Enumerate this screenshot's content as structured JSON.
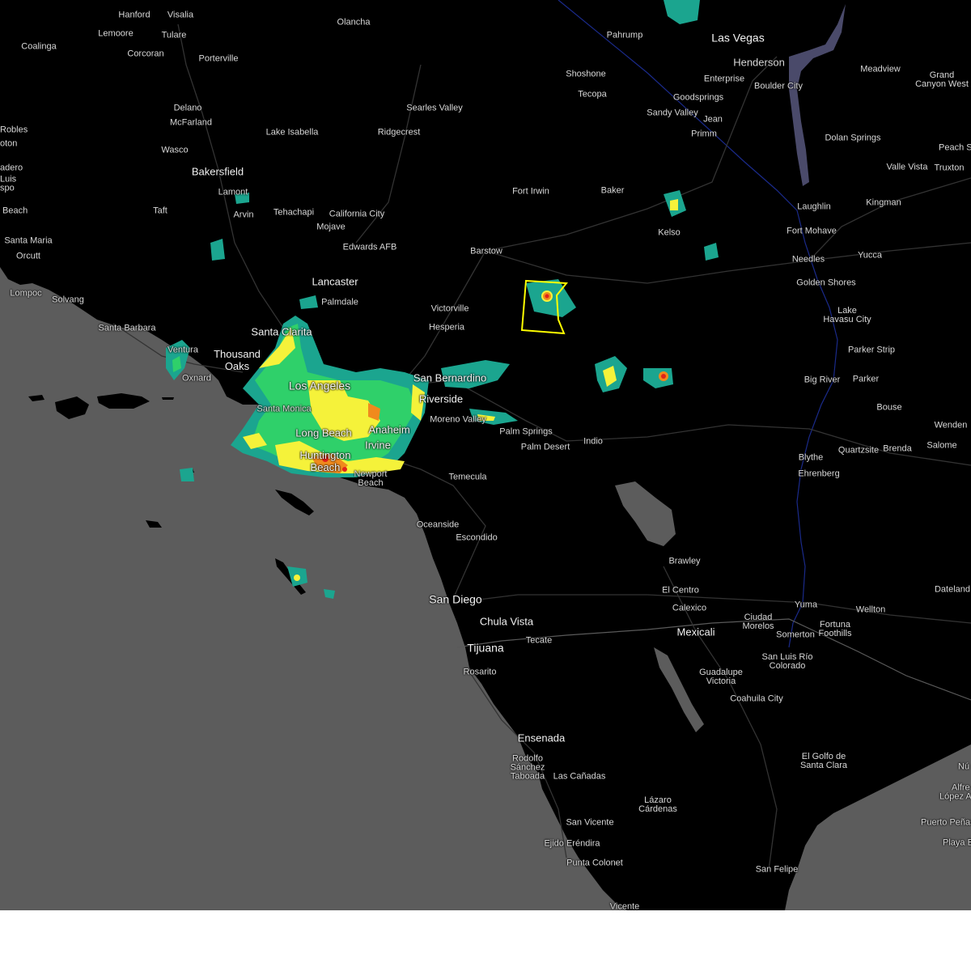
{
  "map": {
    "colors": {
      "land": "#000000",
      "ocean": "#5c5c5c",
      "roads": "#3c3c3c",
      "borders": "#5a5a5a",
      "state_line": "#1a2a8a",
      "warning_polygon": "#ffff00",
      "radar_light": "#1ba58f",
      "radar_mid": "#2fd06a",
      "radar_yellow": "#f5f23a",
      "radar_orange": "#f08a1d",
      "radar_red": "#e2231a"
    },
    "labels": {
      "hanford": "Hanford",
      "visalia": "Visalia",
      "lemoore": "Lemoore",
      "tulare": "Tulare",
      "coalinga": "Coalinga",
      "corcoran": "Corcoran",
      "porterville": "Porterville",
      "olancha": "Olancha",
      "pahrump": "Pahrump",
      "las_vegas": "Las Vegas",
      "henderson": "Henderson",
      "enterprise": "Enterprise",
      "boulder_city": "Boulder City",
      "meadview": "Meadview",
      "grand_canyon_west": "Grand\nCanyon West",
      "shoshone": "Shoshone",
      "tecopa": "Tecopa",
      "goodsprings": "Goodsprings",
      "sandy_valley": "Sandy Valley",
      "jean": "Jean",
      "primm": "Primm",
      "delano": "Delano",
      "mcfarland": "McFarland",
      "lake_isabella": "Lake Isabella",
      "searles_valley": "Searles Valley",
      "ridgecrest": "Ridgecrest",
      "robles": "Robles",
      "oton": "oton",
      "wasco": "Wasco",
      "bakersfield": "Bakersfield",
      "dolan_springs": "Dolan Springs",
      "peach_s": "Peach S",
      "adero": "adero",
      "luis": "Luis",
      "spo": "spo",
      "lamont": "Lamont",
      "arvin": "Arvin",
      "valle_vista": "Valle Vista",
      "truxton": "Truxton",
      "fort_irwin": "Fort Irwin",
      "baker": "Baker",
      "beach": "Beach",
      "taft": "Taft",
      "tehachapi": "Tehachapi",
      "california_city": "California City",
      "laughlin": "Laughlin",
      "kingman": "Kingman",
      "mojave": "Mojave",
      "kelso": "Kelso",
      "fort_mohave": "Fort Mohave",
      "santa_maria": "Santa Maria",
      "edwards_afb": "Edwards AFB",
      "barstow": "Barstow",
      "orcutt": "Orcutt",
      "needles": "Needles",
      "yucca": "Yucca",
      "golden_shores": "Golden Shores",
      "lancaster": "Lancaster",
      "lompoc": "Lompoc",
      "solvang": "Solvang",
      "palmdale": "Palmdale",
      "victorville": "Victorville",
      "lake_havasu_city": "Lake\nHavasu City",
      "santa_barbara": "Santa Barbara",
      "hesperia": "Hesperia",
      "santa_clarita": "Santa Clarita",
      "parker_strip": "Parker Strip",
      "ventura": "Ventura",
      "thousand_oaks": "Thousand\nOaks",
      "oxnard": "Oxnard",
      "san_bernardino": "San Bernardino",
      "big_river": "Big River",
      "parker": "Parker",
      "los_angeles": "Los Angeles",
      "riverside": "Riverside",
      "bouse": "Bouse",
      "santa_monica": "Santa Monica",
      "wenden": "Wenden",
      "moreno_valley": "Moreno Valley",
      "palm_springs": "Palm Springs",
      "long_beach": "Long Beach",
      "anaheim": "Anaheim",
      "salome": "Salome",
      "palm_desert": "Palm Desert",
      "indio": "Indio",
      "irvine": "Irvine",
      "quartzsite": "Quartzsite",
      "brenda": "Brenda",
      "blythe": "Blythe",
      "huntington_beach": "Huntington\nBeach",
      "ehrenberg": "Ehrenberg",
      "newport_beach": "Newport\nBeach",
      "temecula": "Temecula",
      "oceanside": "Oceanside",
      "escondido": "Escondido",
      "brawley": "Brawley",
      "dateland": "Dateland",
      "el_centro": "El Centro",
      "san_diego": "San Diego",
      "yuma": "Yuma",
      "wellton": "Wellton",
      "calexico": "Calexico",
      "chula_vista": "Chula Vista",
      "ciudad_morelos": "Ciudad\nMorelos",
      "fortuna_foothills": "Fortuna\nFoothills",
      "mexicali": "Mexicali",
      "somerton": "Somerton",
      "tijuana": "Tijuana",
      "tecate": "Tecate",
      "san_luis_rio_colorado": "San Luis Río\nColorado",
      "rosarito": "Rosarito",
      "guadalupe_victoria": "Guadalupe\nVictoria",
      "coahuila_city": "Coahuila City",
      "ensenada": "Ensenada",
      "el_golfo": "El Golfo de\nSanta Clara",
      "nu": "Nú",
      "rodolfo_sanchez_taboada": "Rodolfo\nSánchez\nTaboada",
      "las_canadas": "Las Cañadas",
      "alfre": "Alfre",
      "lopez_a": "López A",
      "lazaro_cardenas": "Lázaro\nCárdenas",
      "puerto_penasco": "Puerto Peñas",
      "playa_b": "Playa B",
      "san_vicente": "San Vicente",
      "ejido_erendira": "Ejido Eréndira",
      "san_felipe": "San Felipe",
      "punta_colonet": "Punta Colonet",
      "vicente": "Vicente"
    }
  }
}
